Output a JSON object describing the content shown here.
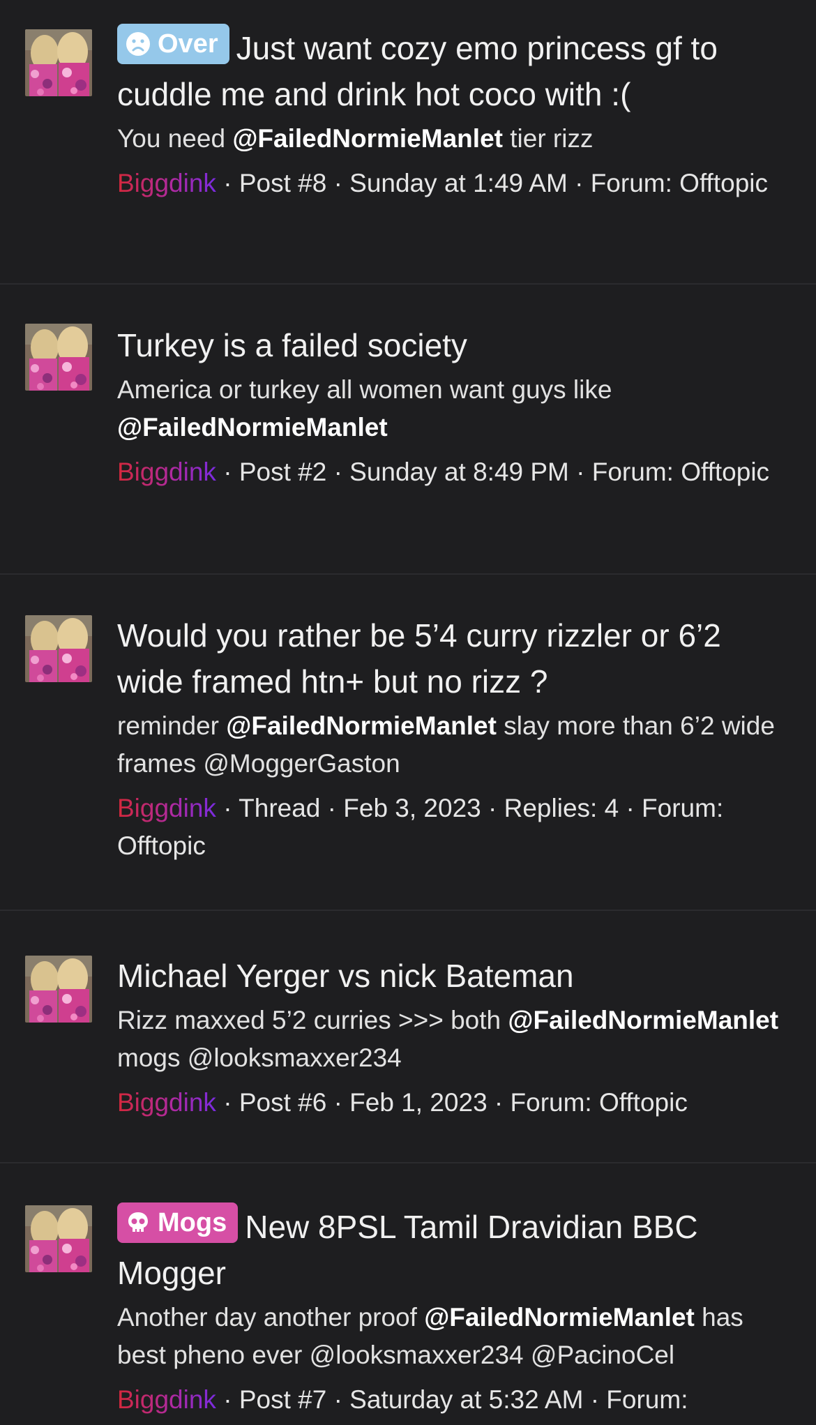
{
  "colors": {
    "background": "#1e1e20",
    "divider": "#2b2b2e",
    "badge_over": "#95c8ea",
    "badge_mogs": "#d64fa5",
    "username_start": "#d4283a",
    "username_end": "#7a2be0"
  },
  "results": [
    {
      "badge": {
        "label": "Over",
        "icon": "sad-face-icon"
      },
      "title": "Just want cozy emo princess gf to cuddle me and drink hot coco with :(",
      "snippet": {
        "pre": "You need ",
        "mention": "@FailedNormieManlet",
        "post": " tier rizz"
      },
      "meta": {
        "user": "Biggdink",
        "rest": " · Post #8 · Sunday at 1:49 AM · Forum: Offtopic"
      }
    },
    {
      "title": "Turkey is a failed society",
      "snippet": {
        "pre": "America or turkey all women want guys like ",
        "mention": "@FailedNormieManlet",
        "post": ""
      },
      "meta": {
        "user": "Biggdink",
        "rest": " · Post #2 · Sunday at 8:49 PM · Forum: Offtopic"
      }
    },
    {
      "title": "Would you rather be 5’4 curry rizzler or 6’2 wide framed htn+ but no rizz ?",
      "snippet": {
        "pre": "reminder ",
        "mention": "@FailedNormieManlet",
        "post": " slay more than 6’2 wide frames @MoggerGaston"
      },
      "meta": {
        "user": "Biggdink",
        "rest": " · Thread · Feb 3, 2023 · Replies: 4 · Forum: Offtopic"
      }
    },
    {
      "title": "Michael Yerger vs nick Bateman",
      "snippet": {
        "pre": "Rizz maxxed 5’2 curries >>> both ",
        "mention": "@FailedNormieManlet",
        "post": " mogs @looksmaxxer234"
      },
      "meta": {
        "user": "Biggdink",
        "rest": " · Post #6 · Feb 1, 2023 · Forum: Offtopic"
      }
    },
    {
      "badge": {
        "label": "Mogs",
        "icon": "skull-icon"
      },
      "title": "New 8PSL Tamil Dravidian BBC Mogger",
      "snippet": {
        "pre": "Another day another proof ",
        "mention": "@FailedNormieManlet",
        "post": " has best pheno ever @looksmaxxer234 @PacinoCel"
      },
      "meta": {
        "user": "Biggdink",
        "rest": " · Post #7 · Saturday at 5:32 AM · Forum:"
      }
    }
  ]
}
